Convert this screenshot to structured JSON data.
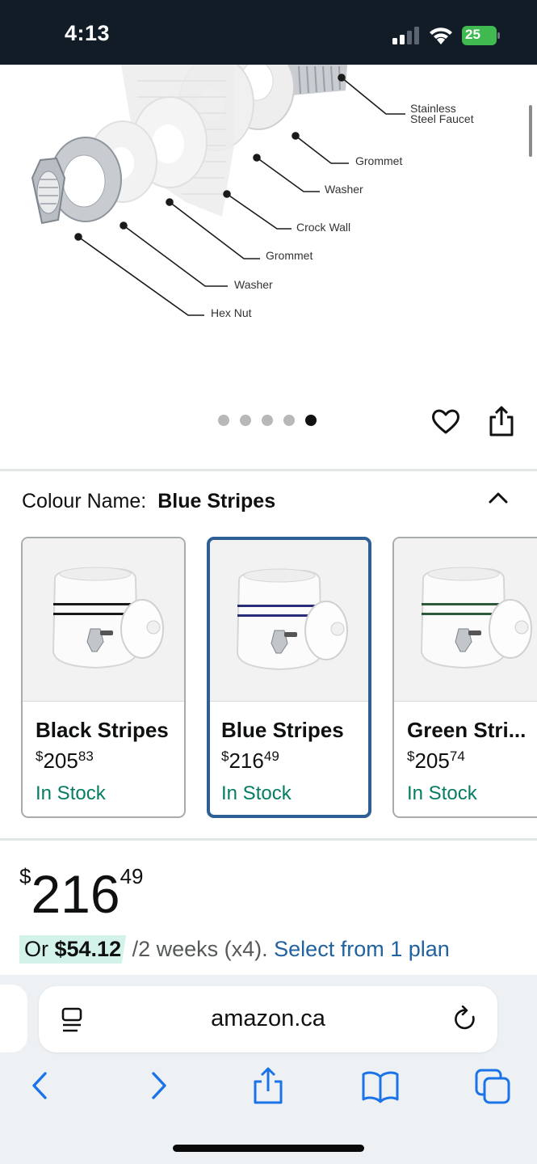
{
  "status_bar": {
    "time": "4:13",
    "battery": "25",
    "icons": [
      "signal-icon",
      "wifi-icon",
      "battery-icon"
    ]
  },
  "product_image": {
    "diagram_labels": {
      "faucet": "Stainless\nSteel Faucet",
      "grommet_top": "Grommet",
      "washer_top": "Washer",
      "crock_wall": "Crock Wall",
      "grommet_bottom": "Grommet",
      "washer_bottom": "Washer",
      "hex_nut": "Hex Nut"
    },
    "carousel": {
      "count": 5,
      "active_index": 4
    }
  },
  "actions": {
    "icons": [
      "heart-icon",
      "share-icon"
    ]
  },
  "colour": {
    "label": "Colour Name:",
    "value": "Blue Stripes",
    "options": [
      {
        "name": "Black Stripes",
        "currency": "$",
        "whole": "205",
        "cents": "83",
        "stock": "In Stock",
        "stripe_color": "#1a1a1a",
        "selected": false
      },
      {
        "name": "Blue Stripes",
        "currency": "$",
        "whole": "216",
        "cents": "49",
        "stock": "In Stock",
        "stripe_color": "#2a2d7a",
        "selected": true
      },
      {
        "name": "Green Stri...",
        "currency": "$",
        "whole": "205",
        "cents": "74",
        "stock": "In Stock",
        "stripe_color": "#2f5a3a",
        "selected": false
      }
    ]
  },
  "price": {
    "currency": "$",
    "whole": "216",
    "cents": "49"
  },
  "plan": {
    "prefix": "Or ",
    "amount": "$54.12",
    "suffix": " /2 weeks (x4). ",
    "link": "Select from 1 plan"
  },
  "browser": {
    "url": "amazon.ca",
    "icons": [
      "reader-icon",
      "reload-icon",
      "back-icon",
      "forward-icon",
      "share-icon",
      "bookmarks-icon",
      "tabs-icon"
    ]
  },
  "colors": {
    "status_bar_bg": "#111c27",
    "in_stock": "#067d62",
    "link": "#2162a1",
    "selected_border": "#2e6096",
    "plan_highlight": "#d3f2e9"
  }
}
